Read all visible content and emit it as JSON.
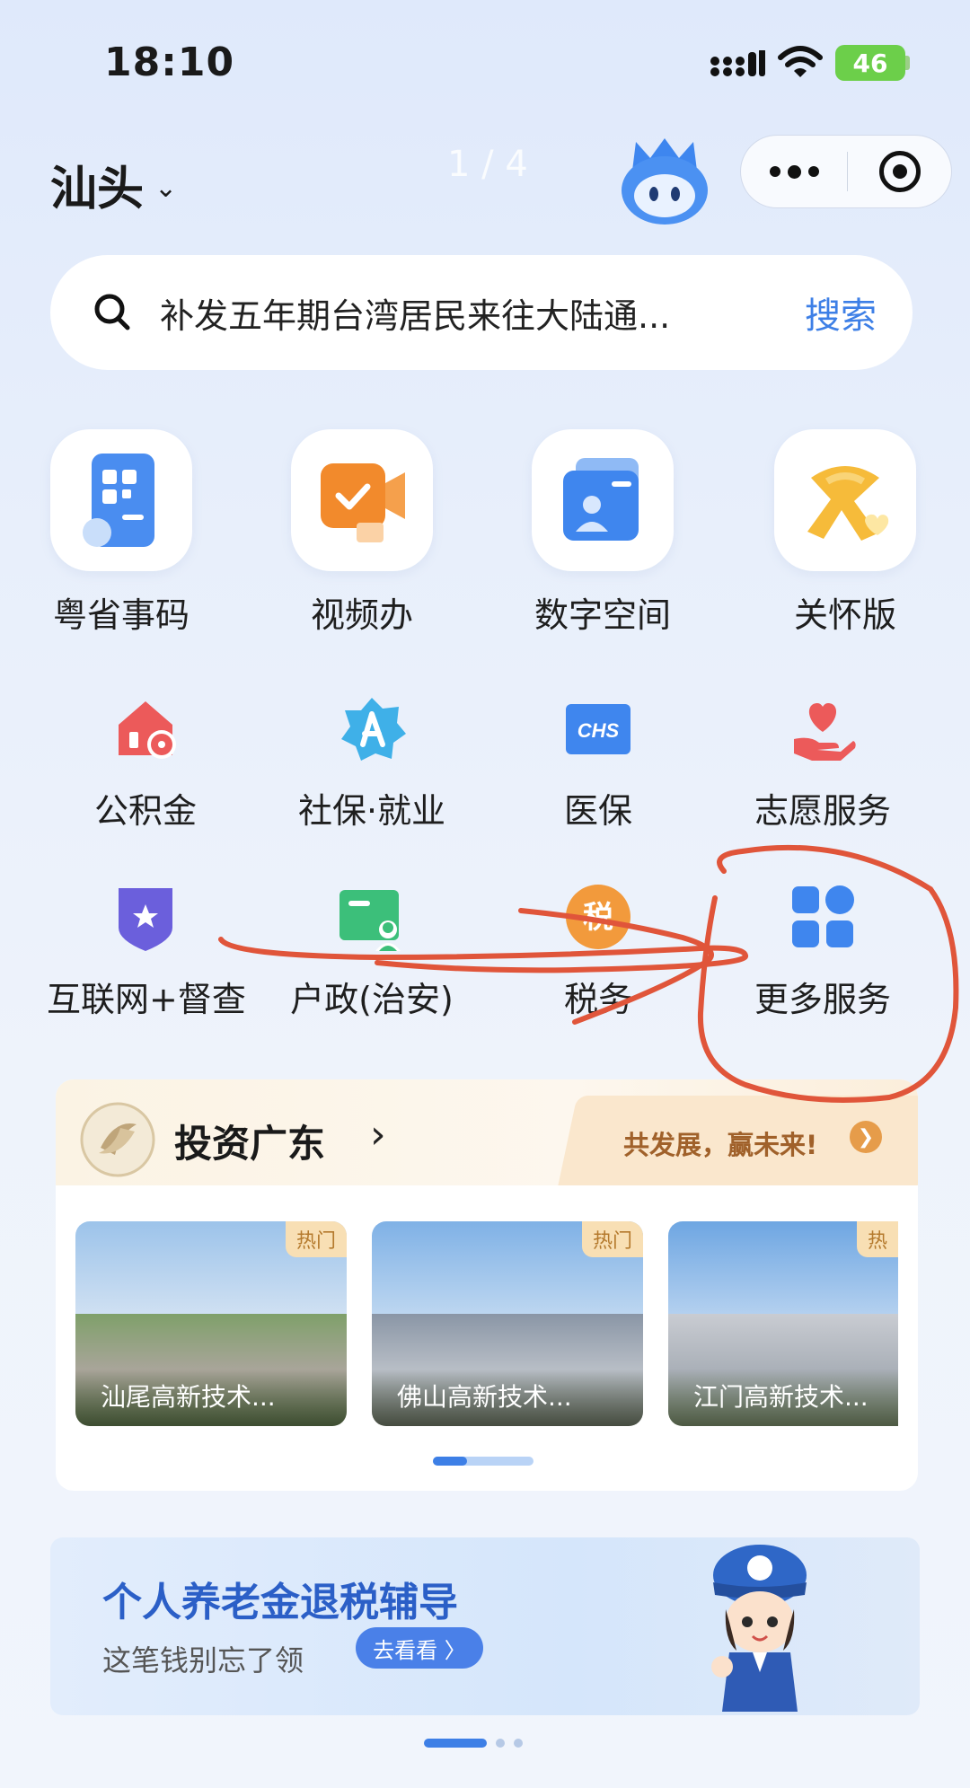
{
  "status_bar": {
    "time": "18:10",
    "battery": "46"
  },
  "header": {
    "city": "汕头",
    "page_indicator": "1 / 4"
  },
  "search": {
    "placeholder": "补发五年期台湾居民来往大陆通...",
    "button": "搜索"
  },
  "top_shortcuts": [
    {
      "label": "粤省事码",
      "icon": "qr-code-icon"
    },
    {
      "label": "视频办",
      "icon": "video-call-icon"
    },
    {
      "label": "数字空间",
      "icon": "digital-space-icon"
    },
    {
      "label": "关怀版",
      "icon": "care-ribbon-icon"
    }
  ],
  "services": [
    {
      "label": "公积金",
      "icon": "housing-fund-icon"
    },
    {
      "label": "社保·就业",
      "icon": "social-security-icon"
    },
    {
      "label": "医保",
      "icon": "medical-insurance-icon"
    },
    {
      "label": "志愿服务",
      "icon": "volunteer-heart-icon"
    },
    {
      "label": "互联网+督查",
      "icon": "supervision-shield-icon"
    },
    {
      "label": "户政(治安)",
      "icon": "household-id-icon"
    },
    {
      "label": "税务",
      "icon": "tax-icon"
    },
    {
      "label": "更多服务",
      "icon": "more-grid-icon"
    }
  ],
  "icon_text": {
    "chs": "CHS",
    "tax": "税"
  },
  "invest": {
    "title": "投资广东",
    "slogan": "共发展，赢未来!",
    "cards": [
      {
        "badge": "热门",
        "caption": "汕尾高新技术..."
      },
      {
        "badge": "热门",
        "caption": "佛山高新技术..."
      },
      {
        "badge": "热",
        "caption": "江门高新技术..."
      }
    ]
  },
  "banner": {
    "title": "个人养老金退税辅导",
    "subtitle": "这笔钱别忘了领",
    "button": "去看看 〉"
  },
  "colors": {
    "accent": "#3d7fe6",
    "annotation": "#e0553a",
    "gold": "#e69c4a"
  }
}
